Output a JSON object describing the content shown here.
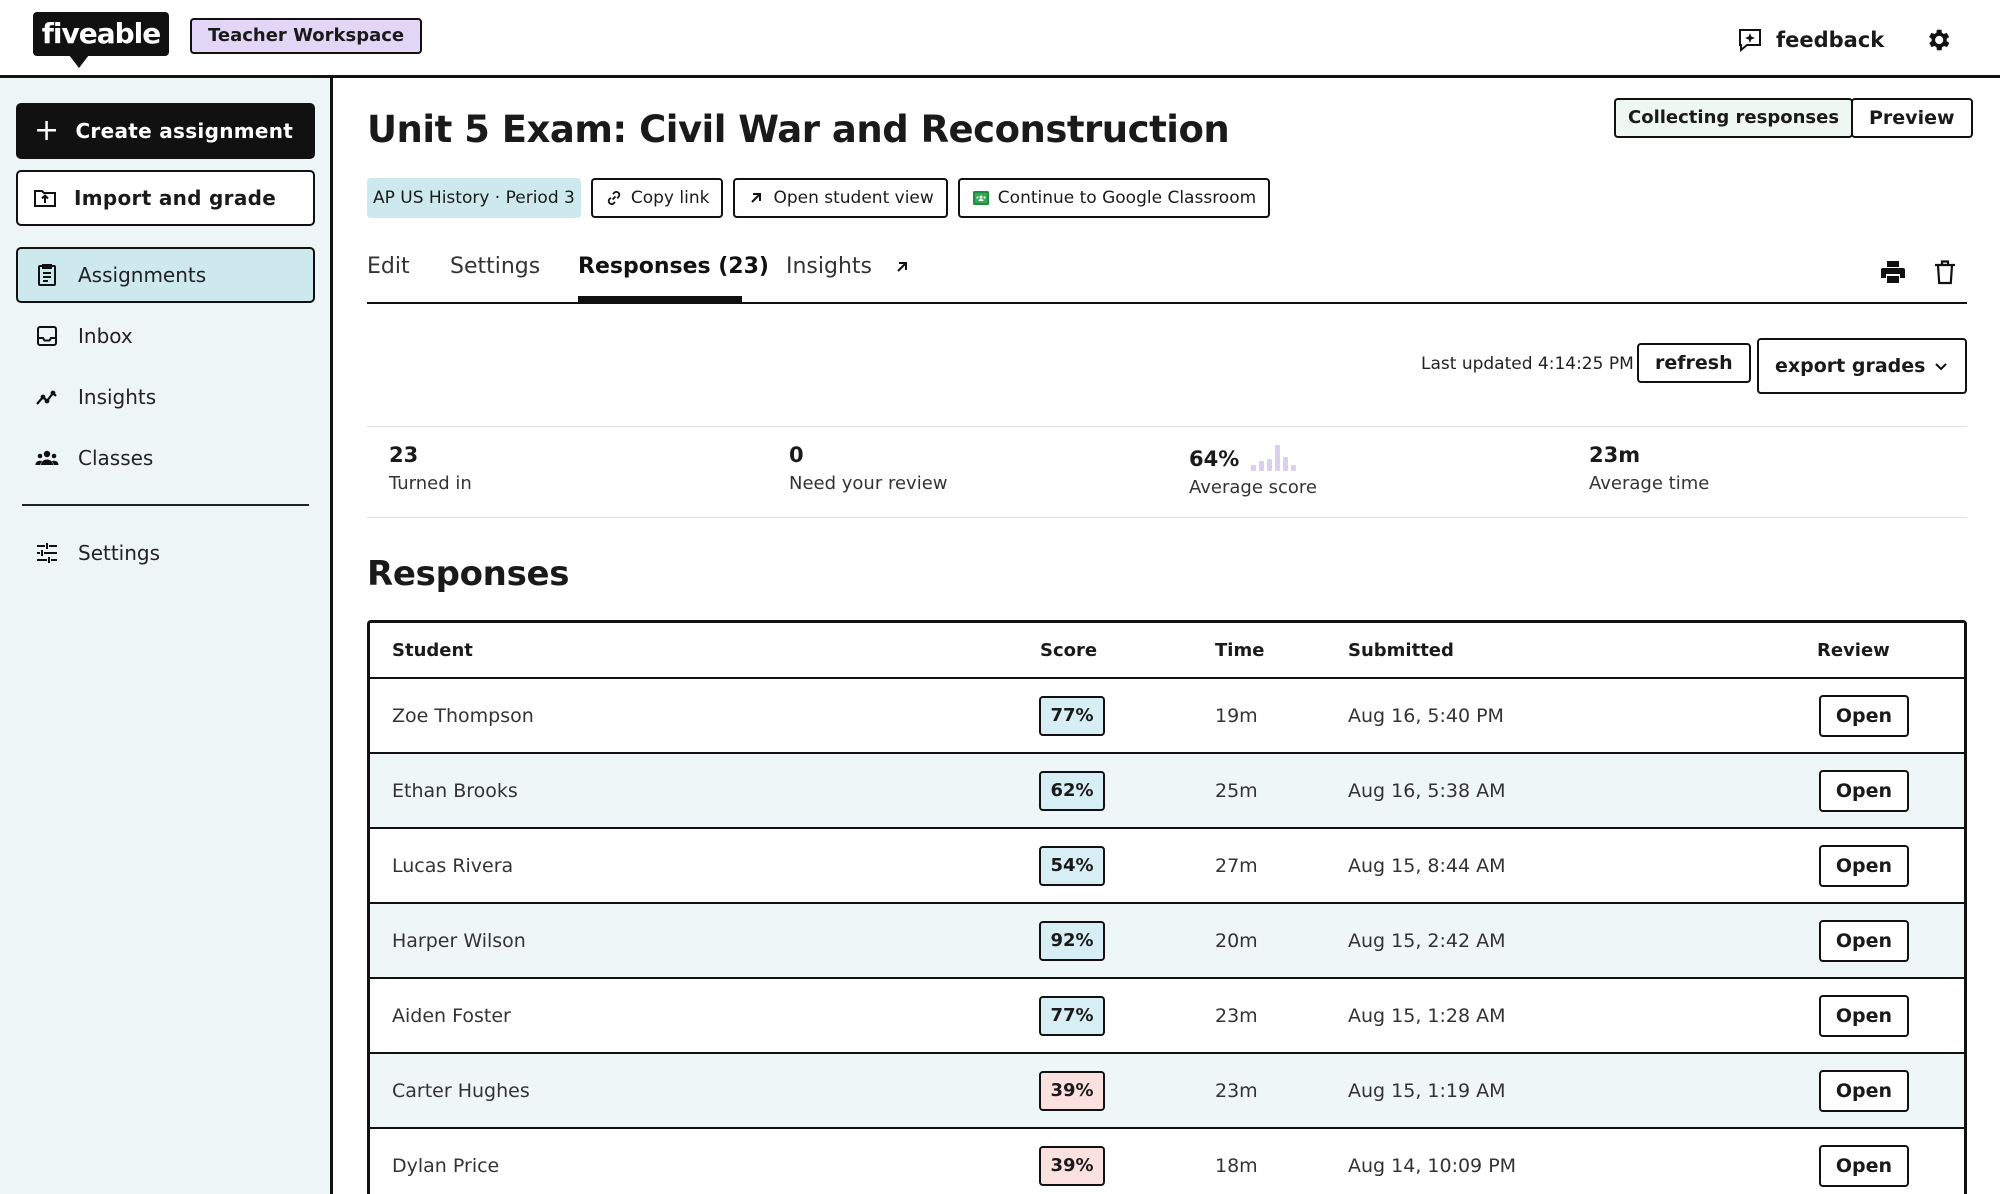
{
  "header": {
    "logo_text": "fiveable",
    "workspace_label": "Teacher Workspace",
    "feedback_label": "feedback"
  },
  "sidebar": {
    "create_label": "Create assignment",
    "import_label": "Import and grade",
    "items": [
      {
        "label": "Assignments",
        "icon": "clipboard-icon",
        "active": true
      },
      {
        "label": "Inbox",
        "icon": "inbox-icon",
        "active": false
      },
      {
        "label": "Insights",
        "icon": "trend-icon",
        "active": false
      },
      {
        "label": "Classes",
        "icon": "people-icon",
        "active": false
      }
    ],
    "settings_label": "Settings"
  },
  "assignment": {
    "title": "Unit 5 Exam: Civil War and Reconstruction",
    "status_label": "Collecting responses",
    "preview_label": "Preview",
    "class_label": "AP US History · Period 3",
    "copy_link_label": "Copy link",
    "student_view_label": "Open student view",
    "google_label": "Continue to Google Classroom"
  },
  "tabs": [
    {
      "label": "Edit",
      "active": false
    },
    {
      "label": "Settings",
      "active": false
    },
    {
      "label": "Responses (23)",
      "active": true
    },
    {
      "label": "Insights",
      "active": false
    }
  ],
  "toolbar": {
    "last_updated": "Last updated 4:14:25 PM",
    "refresh_label": "refresh",
    "export_label": "export grades"
  },
  "stats": [
    {
      "value": "23",
      "label": "Turned in"
    },
    {
      "value": "0",
      "label": "Need your review"
    },
    {
      "value": "64%",
      "label": "Average score"
    },
    {
      "value": "23m",
      "label": "Average time"
    }
  ],
  "responses": {
    "title": "Responses",
    "columns": [
      "Student",
      "Score",
      "Time",
      "Submitted",
      "Review"
    ],
    "open_label": "Open",
    "rows": [
      {
        "student": "Zoe Thompson",
        "score": "77%",
        "time": "19m",
        "submitted": "Aug 16, 5:40 PM",
        "score_color": "#d6eef4"
      },
      {
        "student": "Ethan Brooks",
        "score": "62%",
        "time": "25m",
        "submitted": "Aug 16, 5:38 AM",
        "score_color": "#d6eef4"
      },
      {
        "student": "Lucas Rivera",
        "score": "54%",
        "time": "27m",
        "submitted": "Aug 15, 8:44 AM",
        "score_color": "#d6eef4"
      },
      {
        "student": "Harper Wilson",
        "score": "92%",
        "time": "20m",
        "submitted": "Aug 15, 2:42 AM",
        "score_color": "#d6eef4"
      },
      {
        "student": "Aiden Foster",
        "score": "77%",
        "time": "23m",
        "submitted": "Aug 15, 1:28 AM",
        "score_color": "#d6eef4"
      },
      {
        "student": "Carter Hughes",
        "score": "39%",
        "time": "23m",
        "submitted": "Aug 15, 1:19 AM",
        "score_color": "#fbe0e0"
      },
      {
        "student": "Dylan Price",
        "score": "39%",
        "time": "18m",
        "submitted": "Aug 14, 10:09 PM",
        "score_color": "#fbe0e0"
      }
    ]
  }
}
